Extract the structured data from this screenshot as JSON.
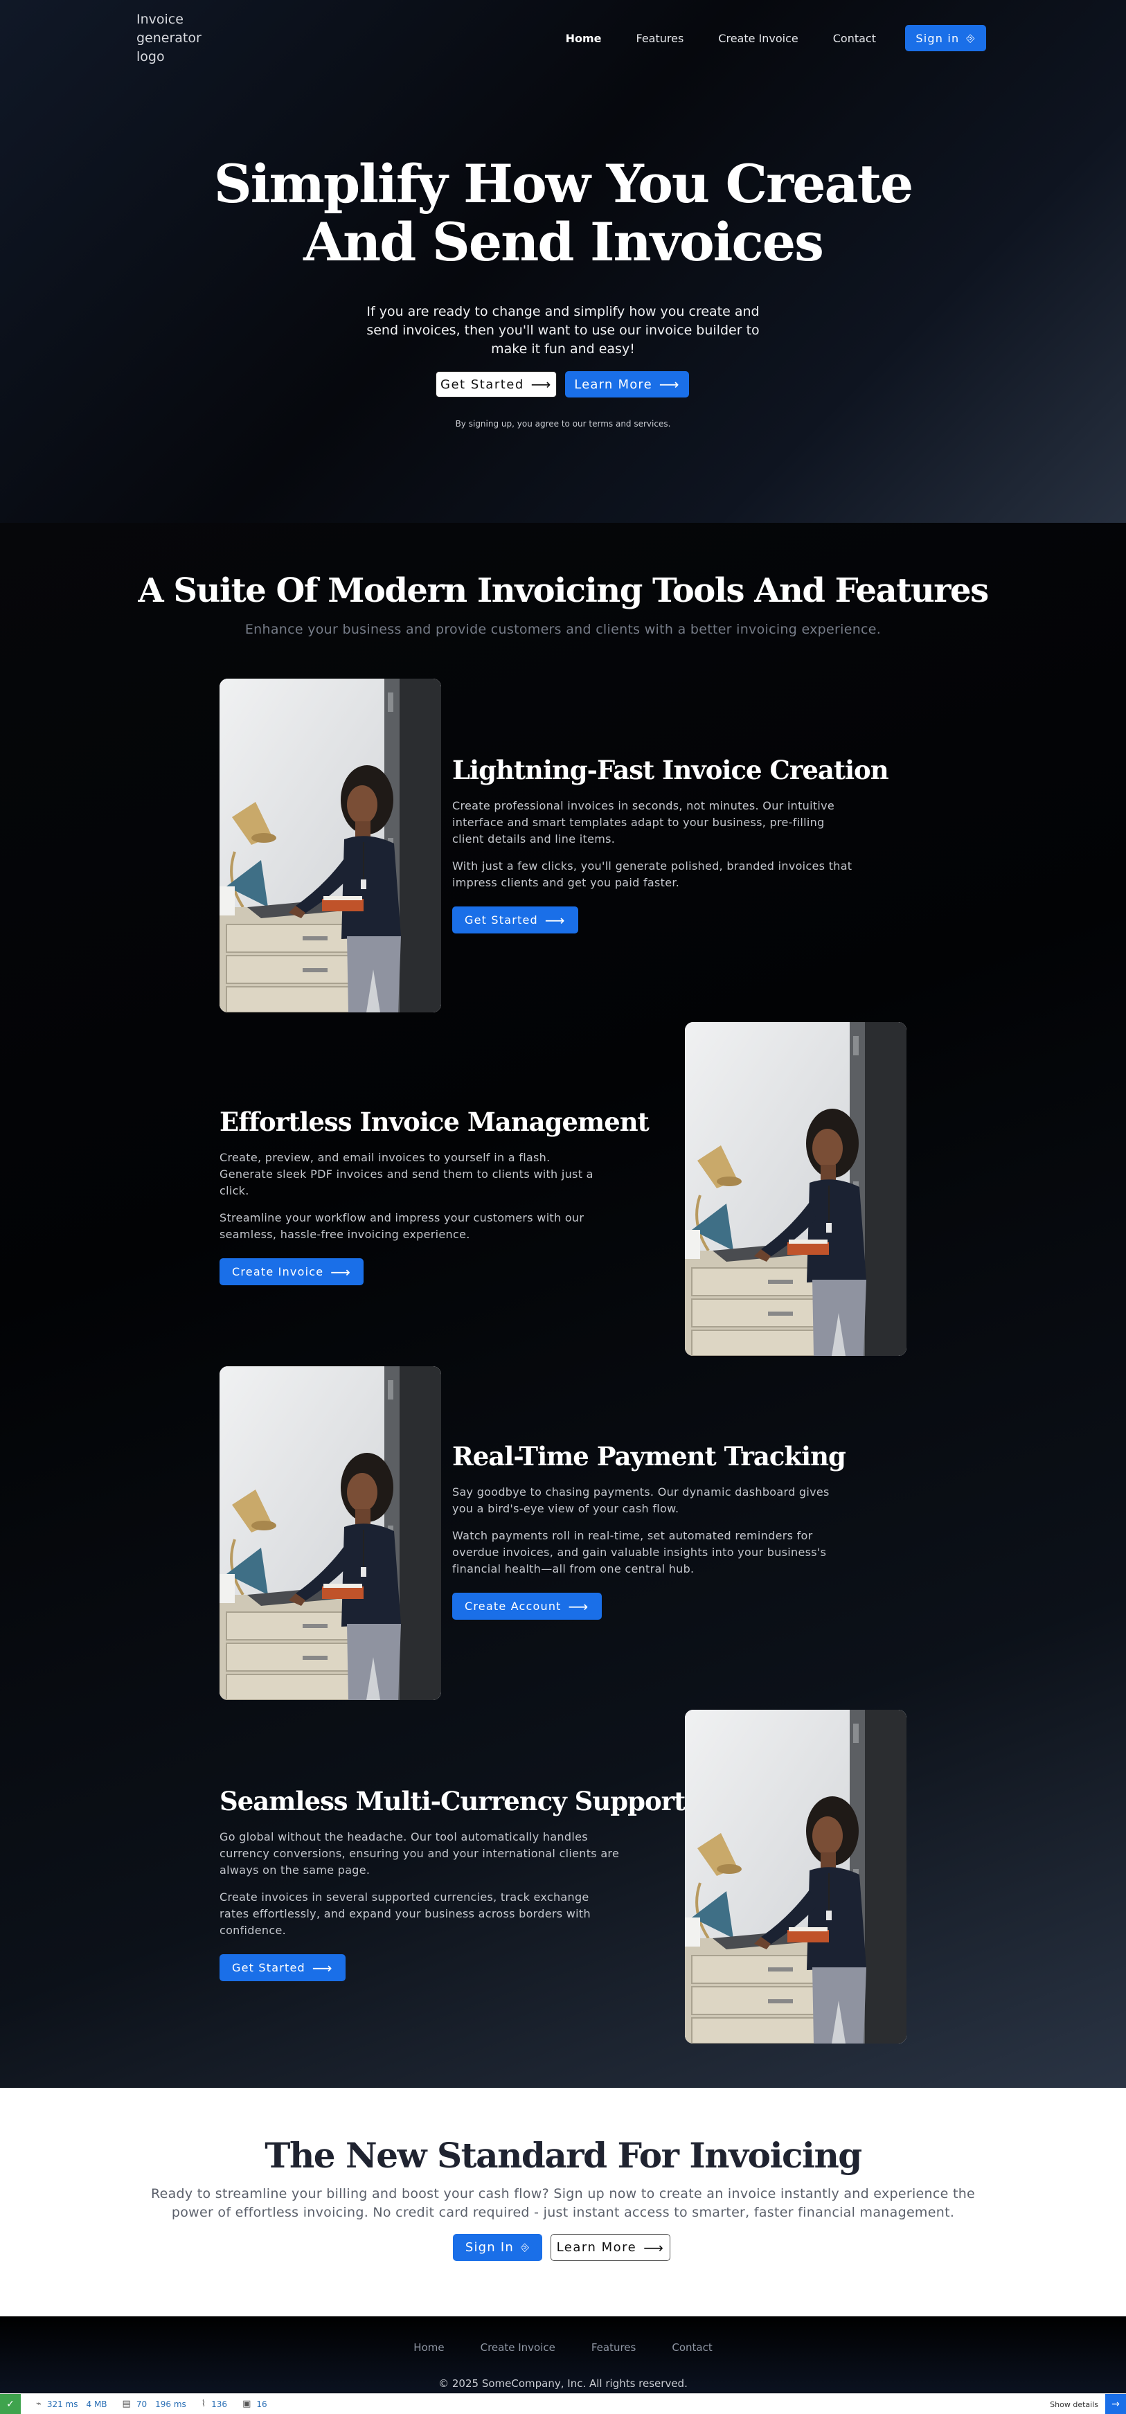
{
  "header": {
    "logo_text": "Invoice generator logo",
    "nav": [
      "Home",
      "Features",
      "Create Invoice",
      "Contact"
    ],
    "signin_label": "Sign in"
  },
  "hero": {
    "title_line1": "Simplify How You Create",
    "title_line2": "And Send Invoices",
    "subtitle": "If you are ready to change and simplify how you create and send invoices, then you'll want to use our invoice builder to make it fun and easy!",
    "get_started_label": "Get Started",
    "learn_more_label": "Learn More",
    "terms": "By signing up, you agree to our terms and services."
  },
  "features": {
    "title": "A Suite Of Modern Invoicing Tools And Features",
    "subtitle": "Enhance your business and provide customers and clients with a better invoicing experience.",
    "items": [
      {
        "heading": "Lightning-Fast Invoice Creation",
        "p1": "Create professional invoices in seconds, not minutes. Our intuitive interface and smart templates adapt to your business, pre-filling client details and line items.",
        "p2": "With just a few clicks, you'll generate polished, branded invoices that impress clients and get you paid faster.",
        "button": "Get Started"
      },
      {
        "heading": "Effortless Invoice Management",
        "p1": "Create, preview, and email invoices to yourself in a flash. Generate sleek PDF invoices and send them to clients with just a click.",
        "p2": "Streamline your workflow and impress your customers with our seamless, hassle-free invoicing experience.",
        "button": "Create Invoice"
      },
      {
        "heading": "Real-Time Payment Tracking",
        "p1": "Say goodbye to chasing payments. Our dynamic dashboard gives you a bird's-eye view of your cash flow.",
        "p2": "Watch payments roll in real-time, set automated reminders for overdue invoices, and gain valuable insights into your business's financial health—all from one central hub.",
        "button": "Create Account"
      },
      {
        "heading": "Seamless Multi-Currency Support",
        "p1": "Go global without the headache. Our tool automatically handles currency conversions, ensuring you and your international clients are always on the same page.",
        "p2": "Create invoices in several supported currencies, track exchange rates effortlessly, and expand your business across borders with confidence.",
        "button": "Get Started"
      }
    ]
  },
  "cta": {
    "title": "The New Standard For Invoicing",
    "body": "Ready to streamline your billing and boost your cash flow? Sign up now to create an invoice instantly and experience the power of effortless invoicing. No credit card required - just instant access to smarter, faster financial management.",
    "signin_label": "Sign In",
    "learn_more_label": "Learn More"
  },
  "footer": {
    "nav": [
      "Home",
      "Create Invoice",
      "Features",
      "Contact"
    ],
    "copyright": "© 2025 SomeCompany, Inc. All rights reserved."
  },
  "debug_toolbar": {
    "time": "321 ms",
    "memory": "4 MB",
    "queries_count": "70",
    "queries_time": "196 ms",
    "files": "136",
    "forms": "16",
    "show_details": "Show details"
  },
  "colors": {
    "primary": "#1a6fe8",
    "hero_bg": "#06080d",
    "cta_bg": "#ffffff",
    "debug_success": "#3fa34d"
  },
  "icons": [
    "login-icon",
    "arrow-right-icon",
    "check-icon",
    "database-icon",
    "paperclip-icon",
    "form-icon",
    "expand-icon"
  ]
}
